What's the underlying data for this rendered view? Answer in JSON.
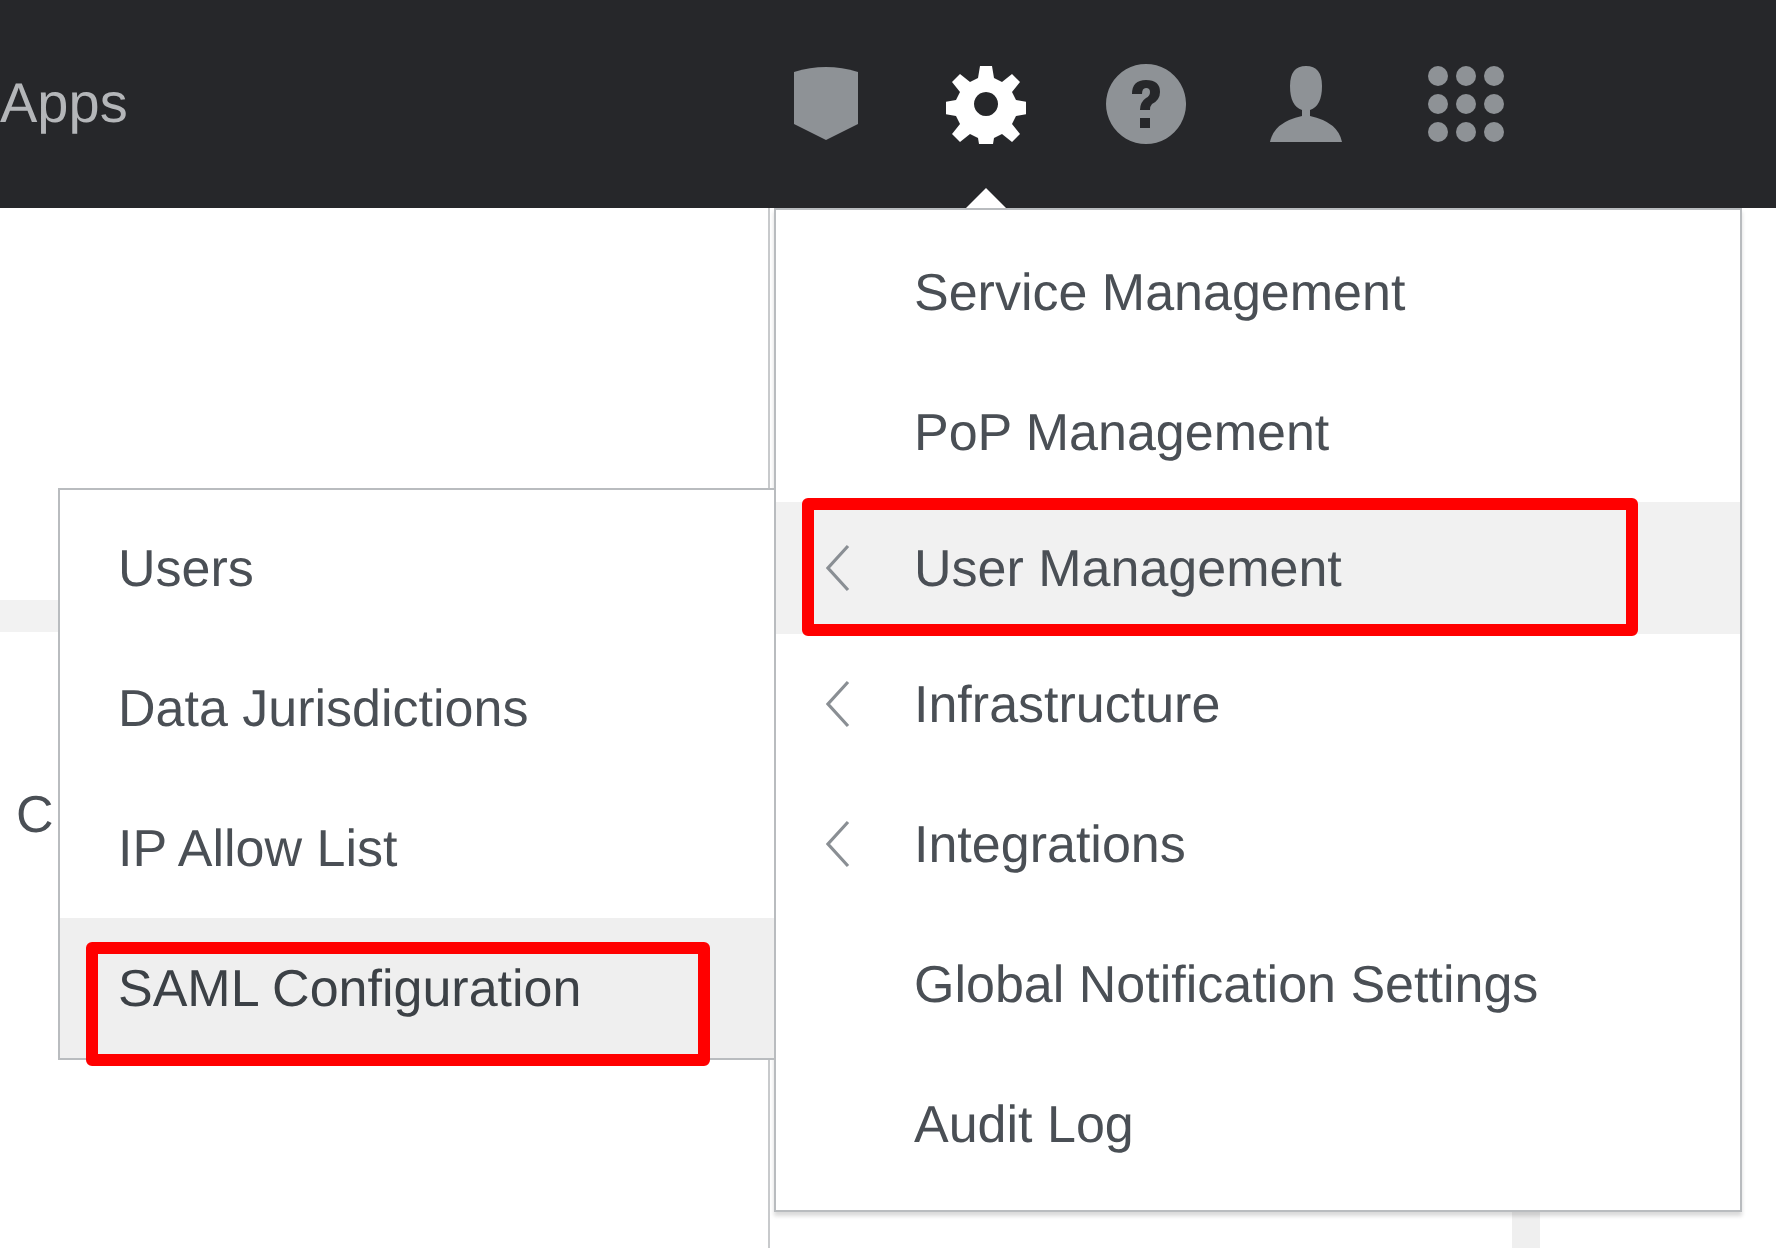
{
  "topbar": {
    "title": "Apps",
    "icons": [
      {
        "kind": "shield",
        "selected": false
      },
      {
        "kind": "gear",
        "selected": true
      },
      {
        "kind": "help",
        "selected": false
      },
      {
        "kind": "person",
        "selected": false
      },
      {
        "kind": "grid",
        "selected": false
      }
    ]
  },
  "page": {
    "text": "C"
  },
  "menu": {
    "items": [
      {
        "label": "Service Management",
        "has_submenu": false,
        "selected": false,
        "annotated": false
      },
      {
        "label": "PoP Management",
        "has_submenu": false,
        "selected": false,
        "annotated": false
      },
      {
        "label": "User Management",
        "has_submenu": true,
        "selected": true,
        "annotated": true
      },
      {
        "label": "Infrastructure",
        "has_submenu": true,
        "selected": false,
        "annotated": false
      },
      {
        "label": "Integrations",
        "has_submenu": true,
        "selected": false,
        "annotated": false
      },
      {
        "label": "Global Notification Settings",
        "has_submenu": false,
        "selected": false,
        "annotated": false
      },
      {
        "label": "Audit Log",
        "has_submenu": false,
        "selected": false,
        "annotated": false
      }
    ]
  },
  "submenu": {
    "items": [
      {
        "label": "Users",
        "selected": false,
        "annotated": false
      },
      {
        "label": "Data Jurisdictions",
        "selected": false,
        "annotated": false
      },
      {
        "label": "IP Allow List",
        "selected": false,
        "annotated": false
      },
      {
        "label": "SAML Configuration",
        "selected": true,
        "annotated": true
      }
    ]
  }
}
